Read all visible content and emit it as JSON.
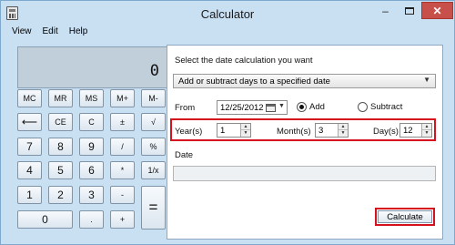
{
  "window": {
    "title": "Calculator",
    "minimize": "–",
    "close": "✕"
  },
  "menu": [
    "View",
    "Edit",
    "Help"
  ],
  "display": {
    "value": "0"
  },
  "keys": {
    "mc": "MC",
    "mr": "MR",
    "ms": "MS",
    "mplus": "M+",
    "mminus": "M-",
    "back": "⟵",
    "ce": "CE",
    "c": "C",
    "plusminus": "±",
    "sqrt": "√",
    "n7": "7",
    "n8": "8",
    "n9": "9",
    "div": "/",
    "pct": "%",
    "n4": "4",
    "n5": "5",
    "n6": "6",
    "mul": "*",
    "recip": "1/x",
    "n1": "1",
    "n2": "2",
    "n3": "3",
    "sub": "-",
    "eq": "=",
    "n0": "0",
    "dot": ".",
    "add": "+"
  },
  "date_calc": {
    "heading": "Select the date calculation you want",
    "mode": "Add or subtract days to a specified date",
    "from_label": "From",
    "from_value": "12/25/2012",
    "add_label": "Add",
    "subtract_label": "Subtract",
    "years_label": "Year(s)",
    "years_value": "1",
    "months_label": "Month(s)",
    "months_value": "3",
    "days_label": "Day(s)",
    "days_value": "12",
    "date_label": "Date",
    "result_value": "",
    "calculate_label": "Calculate"
  }
}
